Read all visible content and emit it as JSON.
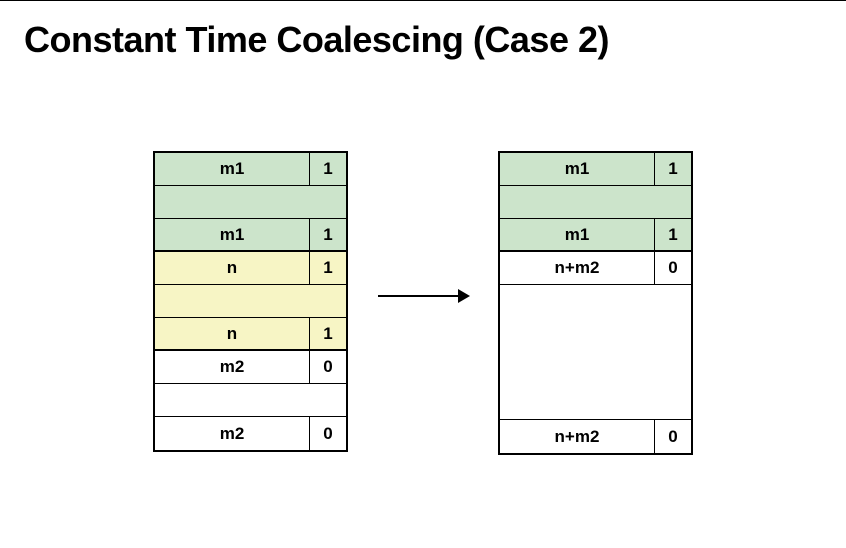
{
  "title": "Constant Time Coalescing (Case 2)",
  "left": {
    "rows": [
      {
        "size": "m1",
        "bit": "1",
        "cls": "green",
        "kind": "header"
      },
      {
        "size": "",
        "bit": "",
        "cls": "green",
        "kind": "payload"
      },
      {
        "size": "m1",
        "bit": "1",
        "cls": "green",
        "kind": "footer",
        "thick": true
      },
      {
        "size": "n",
        "bit": "1",
        "cls": "yellow",
        "kind": "header"
      },
      {
        "size": "",
        "bit": "",
        "cls": "yellow",
        "kind": "payload"
      },
      {
        "size": "n",
        "bit": "1",
        "cls": "yellow",
        "kind": "footer",
        "thick": true
      },
      {
        "size": "m2",
        "bit": "0",
        "cls": "white",
        "kind": "header"
      },
      {
        "size": "",
        "bit": "",
        "cls": "white",
        "kind": "payload"
      },
      {
        "size": "m2",
        "bit": "0",
        "cls": "white",
        "kind": "footer"
      }
    ]
  },
  "right": {
    "rows": [
      {
        "size": "m1",
        "bit": "1",
        "cls": "green",
        "kind": "header"
      },
      {
        "size": "",
        "bit": "",
        "cls": "green",
        "kind": "payload"
      },
      {
        "size": "m1",
        "bit": "1",
        "cls": "green",
        "kind": "footer",
        "thick": true
      },
      {
        "size": "n+m2",
        "bit": "0",
        "cls": "white",
        "kind": "header"
      },
      {
        "size": "",
        "bit": "",
        "cls": "white",
        "kind": "tallpayload"
      },
      {
        "size": "n+m2",
        "bit": "0",
        "cls": "white",
        "kind": "footer"
      }
    ]
  }
}
